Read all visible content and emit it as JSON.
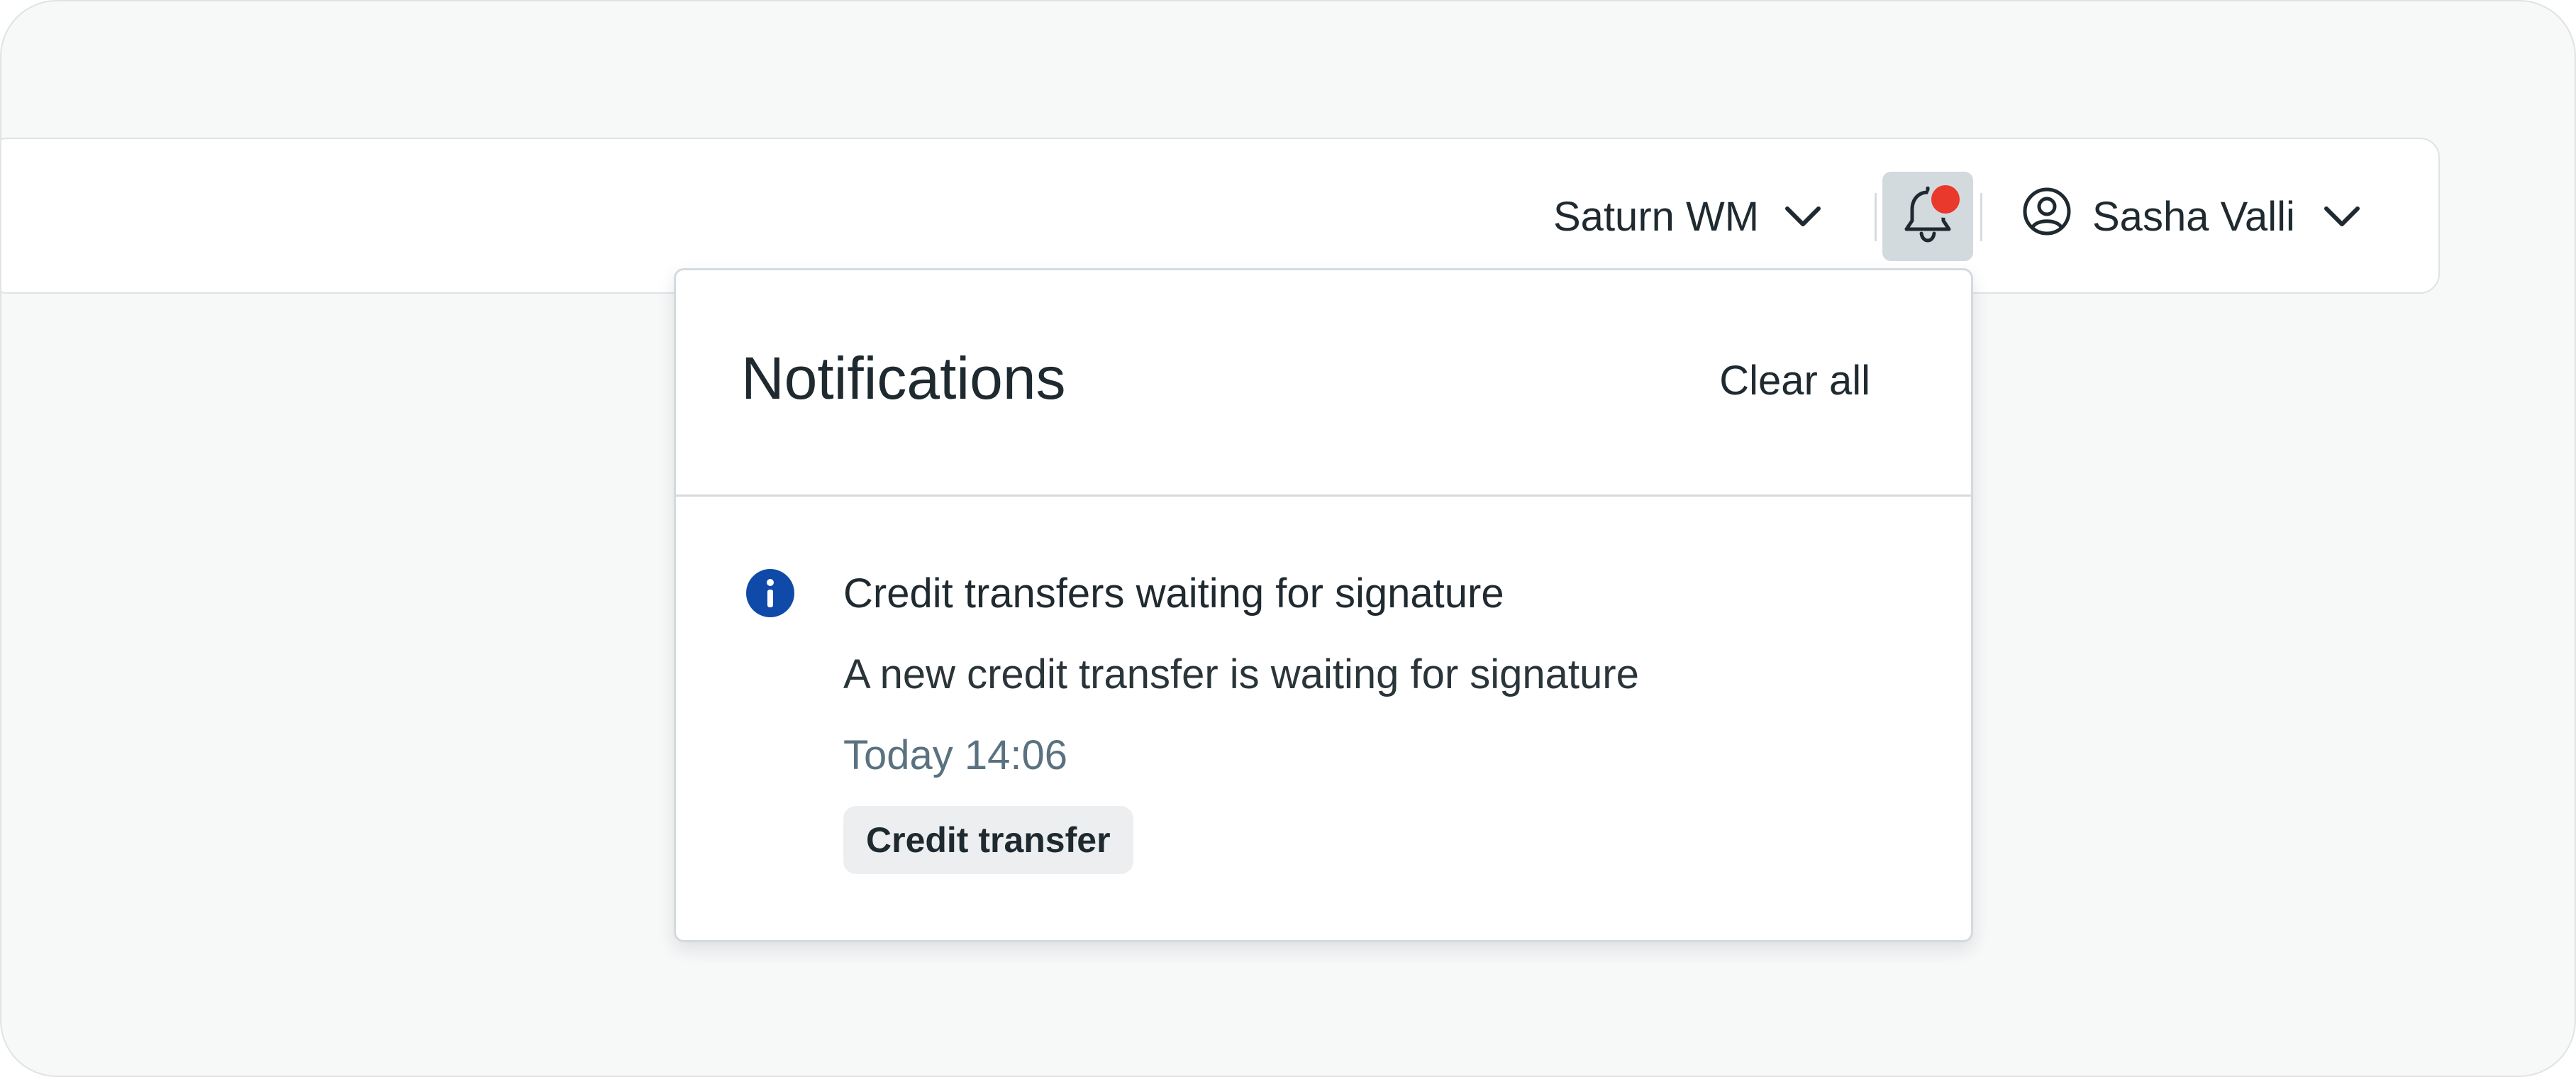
{
  "header": {
    "org_switcher": {
      "label": "Saturn WM",
      "icon": "chevron-down-icon"
    },
    "notifications_button": {
      "icon": "bell-icon",
      "has_unread": true,
      "badge_color": "#e8392c"
    },
    "user_menu": {
      "name": "Sasha Valli",
      "icon": "user-circle-icon"
    }
  },
  "notifications_panel": {
    "title": "Notifications",
    "clear_all_label": "Clear all",
    "items": [
      {
        "icon": "info-icon",
        "icon_color": "#0f4aa8",
        "title": "Credit transfers waiting for signature",
        "body": "A new credit transfer is waiting for signature",
        "time": "Today 14:06",
        "tag": "Credit transfer"
      }
    ]
  }
}
